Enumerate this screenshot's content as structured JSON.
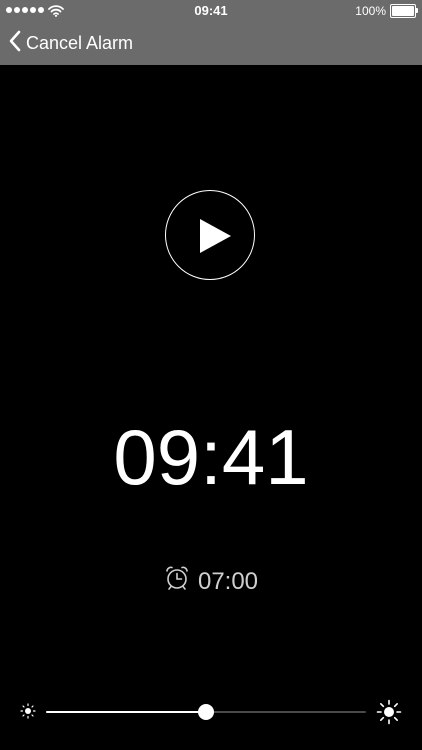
{
  "status_bar": {
    "time": "09:41",
    "battery_text": "100%",
    "signal_icon": "signal-dots-icon",
    "wifi_icon": "wifi-icon",
    "battery_icon": "battery-icon"
  },
  "nav": {
    "back_label": "Cancel Alarm",
    "back_icon": "chevron-left-icon"
  },
  "player": {
    "play_icon": "play-icon"
  },
  "clock": {
    "time": "09:41"
  },
  "alarm": {
    "icon": "alarm-clock-icon",
    "time": "07:00"
  },
  "brightness": {
    "level": 0.5,
    "min_icon": "sun-small-icon",
    "max_icon": "sun-large-icon"
  },
  "colors": {
    "background": "#000000",
    "topbar": "#6b6b6b",
    "foreground": "#ffffff"
  }
}
